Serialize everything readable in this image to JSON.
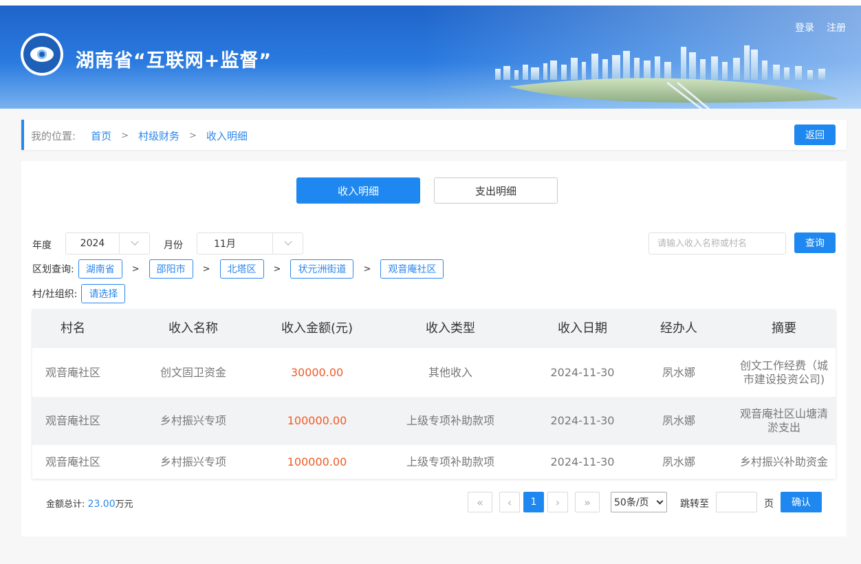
{
  "header": {
    "title": "湖南省“互联网+监督”",
    "login": "登录",
    "register": "注册"
  },
  "breadcrumb": {
    "label": "我的位置:",
    "items": [
      "首页",
      "村级财务",
      "收入明细"
    ],
    "separator": ">",
    "back": "返回"
  },
  "tabs": [
    {
      "label": "收入明细",
      "active": true
    },
    {
      "label": "支出明细",
      "active": false
    }
  ],
  "filters": {
    "year_label": "年度",
    "year_value": "2024",
    "month_label": "月份",
    "month_value": "11月",
    "search_placeholder": "请输入收入名称或村名",
    "query_button": "查询",
    "region_label": "区划查询:",
    "region_items": [
      "湖南省",
      "邵阳市",
      "北塔区",
      "状元洲街道",
      "观音庵社区"
    ],
    "region_sep": ">",
    "org_label": "村/社组织:",
    "org_select": "请选择"
  },
  "table": {
    "headers": [
      "村名",
      "收入名称",
      "收入金额(元)",
      "收入类型",
      "收入日期",
      "经办人",
      "摘要"
    ],
    "rows": [
      [
        "观音庵社区",
        "创文固卫资金",
        "30000.00",
        "其他收入",
        "2024-11-30",
        "夙水娜",
        "创文工作经费（城市建设投资公司)"
      ],
      [
        "观音庵社区",
        "乡村振兴专项",
        "100000.00",
        "上级专项补助款项",
        "2024-11-30",
        "夙水娜",
        "观音庵社区山塘清淤支出"
      ],
      [
        "观音庵社区",
        "乡村振兴专项",
        "100000.00",
        "上级专项补助款项",
        "2024-11-30",
        "夙水娜",
        "乡村振兴补助资金"
      ]
    ]
  },
  "footer": {
    "total_label": "金额总计:",
    "total_value": "23.00",
    "total_unit": "万元",
    "current_page": "1",
    "page_size": "50条/页",
    "jump_label": "跳转至",
    "page_unit": "页",
    "confirm": "确认"
  },
  "colors": {
    "accent": "#1e88f0",
    "amount": "#f05a23",
    "header_blue": "#2a7ae0"
  }
}
